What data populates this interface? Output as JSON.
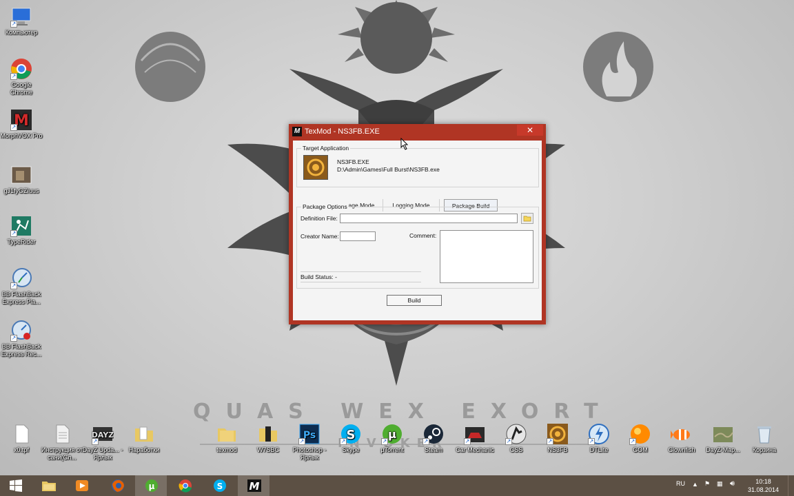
{
  "window": {
    "title": "TexMod - NS3FB.EXE",
    "close_glyph": "✕",
    "logo_letter": "M",
    "target_application": {
      "legend": "Target Application",
      "exe_name": "NS3FB.EXE",
      "exe_path": "D:\\Admin\\Games\\Full Burst\\NS3FB.exe"
    },
    "tabs": [
      {
        "label": "Package Mode",
        "active": false
      },
      {
        "label": "Logging Mode",
        "active": false
      },
      {
        "label": "Package Build",
        "active": true
      }
    ],
    "package_options": {
      "legend": "Package Options",
      "definition_file_label": "Definition File:",
      "definition_file_value": "",
      "creator_name_label": "Creator Name:",
      "creator_name_value": "",
      "comment_label": "Comment:",
      "comment_value": "",
      "build_status_label": "Build Status: -"
    },
    "build_button": "Build"
  },
  "desktop": {
    "left_icons": [
      {
        "label": "Компьютер",
        "icon": "computer-icon"
      },
      {
        "label": "Google Chrome",
        "icon": "chrome-icon"
      },
      {
        "label": "MorphVOX Pro",
        "icon": "morphvox-icon"
      },
      {
        "label": "gJ1fyGZIuus",
        "icon": "video-thumbnail-icon"
      },
      {
        "label": "TypeRider",
        "icon": "typerider-icon"
      },
      {
        "label": "BB FlashBack Express Pla...",
        "icon": "flashback-player-icon"
      },
      {
        "label": "BB FlashBack Express Rec...",
        "icon": "flashback-recorder-icon"
      }
    ],
    "bottom_icons": [
      {
        "label": "x0.tpf",
        "icon": "file-icon"
      },
      {
        "label": "Инструкция от сани(Сл...",
        "icon": "document-icon"
      },
      {
        "label": "DayZ Upda... - Ярлык",
        "icon": "dayz-icon"
      },
      {
        "label": "Наработки",
        "icon": "folder-icon"
      },
      {
        "label": "texmod",
        "icon": "folder-icon"
      },
      {
        "label": "W7SBC",
        "icon": "folder-icon"
      },
      {
        "label": "Photoshop - Ярлык",
        "icon": "photoshop-icon"
      },
      {
        "label": "Skype",
        "icon": "skype-icon"
      },
      {
        "label": "µTorrent",
        "icon": "utorrent-icon"
      },
      {
        "label": "Steam",
        "icon": "steam-icon"
      },
      {
        "label": "Car Mechanic",
        "icon": "car-mechanic-icon"
      },
      {
        "label": "CSS",
        "icon": "counter-strike-icon"
      },
      {
        "label": "NS3FB",
        "icon": "ns3fb-icon"
      },
      {
        "label": "DTLite",
        "icon": "daemon-tools-icon"
      },
      {
        "label": "GOM",
        "icon": "gom-player-icon"
      },
      {
        "label": "Clownfish",
        "icon": "clownfish-icon"
      },
      {
        "label": "DayZ-Map...",
        "icon": "map-icon"
      },
      {
        "label": "Корзина",
        "icon": "recycle-bin-icon"
      }
    ],
    "wallpaper_text": "QUAS WEX EXORT",
    "wallpaper_subtext": "INVOKER"
  },
  "taskbar": {
    "items": [
      {
        "name": "start-button",
        "icon": "windows-logo-icon"
      },
      {
        "name": "explorer",
        "icon": "folder-icon"
      },
      {
        "name": "media-player",
        "icon": "media-player-icon"
      },
      {
        "name": "firefox",
        "icon": "firefox-icon"
      },
      {
        "name": "utorrent",
        "icon": "utorrent-icon",
        "active": true
      },
      {
        "name": "chrome",
        "icon": "chrome-icon"
      },
      {
        "name": "skype",
        "icon": "skype-icon"
      },
      {
        "name": "texmod",
        "icon": "texmod-icon",
        "active": true
      }
    ],
    "language": "RU",
    "time": "10:18",
    "date": "31.08.2014"
  },
  "colors": {
    "titlebar": "#b03524",
    "close_button": "#c7392a",
    "taskbar": "#5c5044"
  }
}
